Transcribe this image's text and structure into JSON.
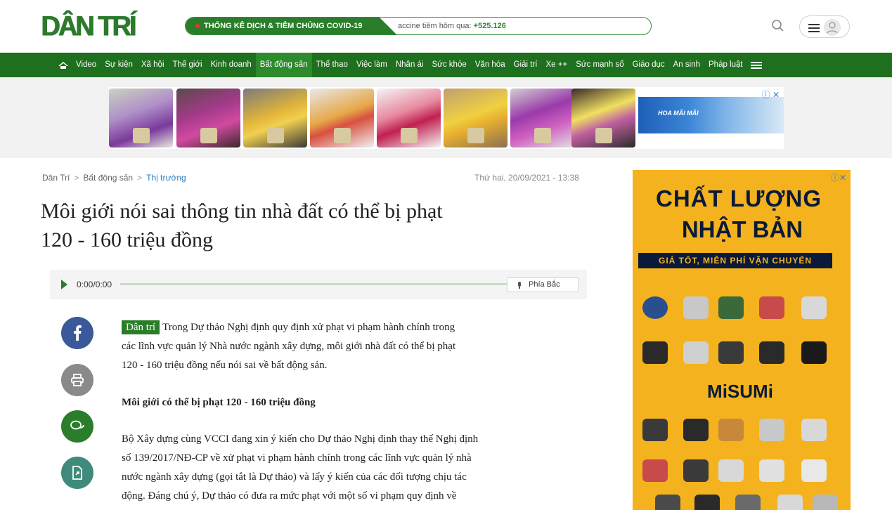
{
  "brand": {
    "logo_text": "DÂN TRÍ",
    "color": "#2c7a2c"
  },
  "covid": {
    "label": "THỐNG KÊ DỊCH & TIÊM CHỦNG COVID-19",
    "ticker_text": "accine tiêm hôm qua:",
    "ticker_value": "+525.126"
  },
  "header": {
    "search_icon": "search-icon",
    "menu_icon": "hamburger-icon",
    "user_icon": "user-icon"
  },
  "nav": {
    "home_icon": "home-icon",
    "items": [
      "Video",
      "Sự kiện",
      "Xã hội",
      "Thế giới",
      "Kinh doanh",
      "Bất động sản",
      "Thể thao",
      "Việc làm",
      "Nhân ái",
      "Sức khỏe",
      "Văn hóa",
      "Giải trí",
      "Xe ++",
      "Sức mạnh số",
      "Giáo dục",
      "An sinh",
      "Pháp luật"
    ],
    "active": "Bất động sản",
    "more_icon": "menu-icon"
  },
  "banner_ad": {
    "brand_text": "HOA MÃI MÃI",
    "adchoices": "ⓘ ✕"
  },
  "article": {
    "breadcrumb": [
      "Dân Trí",
      "Bất động sản",
      "Thị trường"
    ],
    "date": "Thứ hai, 20/09/2021 - 13:38",
    "title_line1": "Môi giới nói sai thông tin nhà đất có thể bị phạt",
    "title_line2": "120 - 160 triệu đồng",
    "audio": {
      "time": "0:00/0:00",
      "voice": "Phía Bắc"
    },
    "sapo_tag": "Dân trí",
    "sapo_line1": "Trong Dự thảo Nghị định quy định xử phạt vi phạm hành chính trong",
    "sapo_line2": "các lĩnh vực quản lý Nhà nước ngành xây dựng, môi giới nhà đất có thể bị phạt",
    "sapo_line3": "120 - 160 triệu đồng nếu nói sai về bất động sản.",
    "subhead": "Môi giới có thể bị phạt 120 - 160 triệu đồng",
    "para_line1": "Bộ Xây dựng cùng VCCI đang xin ý kiến cho Dự thảo Nghị định thay thế Nghị định",
    "para_line2": "số 139/2017/NĐ-CP về xử phạt vi phạm hành chính trong các lĩnh vực quản lý nhà",
    "para_line3": "nước ngành xây dựng (gọi tắt là Dự thảo) và lấy ý kiến của các đối tượng chịu tác",
    "para_line4": "động. Đáng chú ý, Dự thảo có đưa ra mức phạt với một số vi phạm quy định về"
  },
  "social": [
    "facebook-icon",
    "print-icon",
    "comment-icon",
    "share-icon"
  ],
  "side_ad": {
    "adchoices": "ⓘ✕",
    "headline1": "CHẤT LƯỢNG",
    "headline2": "NHẬT BẢN",
    "strip": "GIÁ TỐT, MIỄN PHÍ VẬN CHUYỂN",
    "brand": "MiSUMi",
    "bg_color": "#f4b21e"
  }
}
